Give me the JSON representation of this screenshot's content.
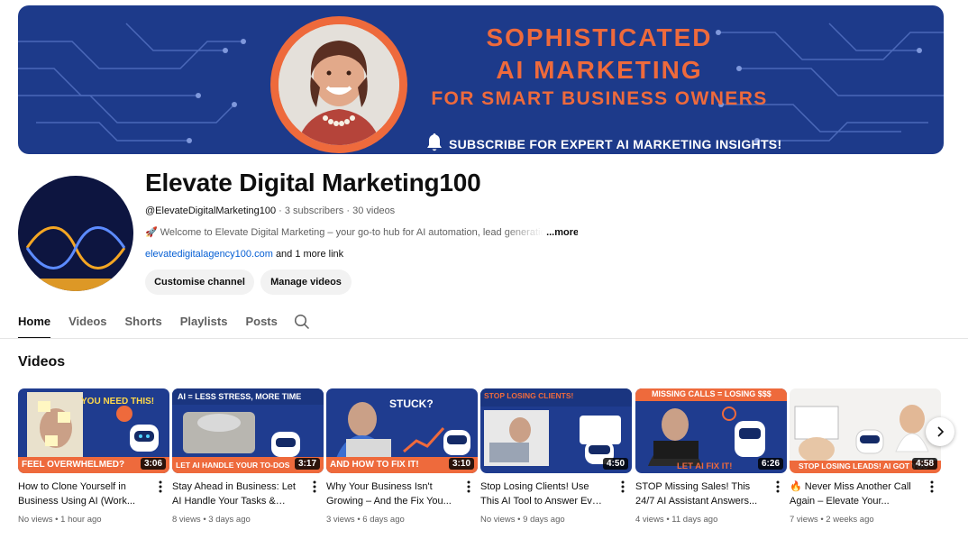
{
  "banner": {
    "line1": "SOPHISTICATED",
    "line2": "AI MARKETING",
    "line3": "FOR SMART BUSINESS OWNERS",
    "subscribe": "SUBSCRIBE FOR EXPERT AI MARKETING INSIGHTS!",
    "bg_color": "#1d3a8a",
    "accent_color": "#ee6a3c"
  },
  "channel": {
    "name": "Elevate Digital Marketing100",
    "handle": "@ElevateDigitalMarketing100",
    "subscribers": "3 subscribers",
    "videos_count": "30 videos",
    "description": "🚀 Welcome to Elevate Digital Marketing – your go-to hub for AI automation, lead generation",
    "more_label": "...more",
    "link_text": "elevatedigitalagency100.com",
    "more_links": "and 1 more link",
    "customise_label": "Customise channel",
    "manage_label": "Manage videos"
  },
  "tabs": [
    "Home",
    "Videos",
    "Shorts",
    "Playlists",
    "Posts"
  ],
  "section_title": "Videos",
  "videos": [
    {
      "title": "How to Clone Yourself in Business Using AI (Work...",
      "views": "No views",
      "age": "1 hour ago",
      "duration": "3:06",
      "thumb_text_top": "YOU NEED THIS!",
      "thumb_text_bottom": "FEEL OVERWHELMED?"
    },
    {
      "title": "Stay Ahead in Business: Let AI Handle Your Tasks & Fre...",
      "views": "8 views",
      "age": "3 days ago",
      "duration": "3:17",
      "thumb_text_top": "AI = LESS STRESS, MORE TIME",
      "thumb_text_bottom": "LET AI HANDLE YOUR TO-DOS"
    },
    {
      "title": "Why Your Business Isn't Growing – And the Fix You...",
      "views": "3 views",
      "age": "6 days ago",
      "duration": "3:10",
      "thumb_text_top": "STUCK?",
      "thumb_text_bottom": "AND HOW TO FIX IT!"
    },
    {
      "title": "Stop Losing Clients! Use This AI Tool to Answer Every Call...",
      "views": "No views",
      "age": "9 days ago",
      "duration": "4:50",
      "thumb_text_top": "STOP LOSING CLIENTS!",
      "thumb_text_bottom": ""
    },
    {
      "title": "STOP Missing Sales! This 24/7 AI Assistant Answers...",
      "views": "4 views",
      "age": "11 days ago",
      "duration": "6:26",
      "thumb_text_top": "MISSING CALLS = LOSING $$$",
      "thumb_text_bottom": "LET AI FIX IT!"
    },
    {
      "title": "🔥 Never Miss Another Call Again – Elevate Your...",
      "views": "7 views",
      "age": "2 weeks ago",
      "duration": "4:58",
      "thumb_text_top": "",
      "thumb_text_bottom": "STOP LOSING LEADS! AI GOT YOU"
    }
  ]
}
